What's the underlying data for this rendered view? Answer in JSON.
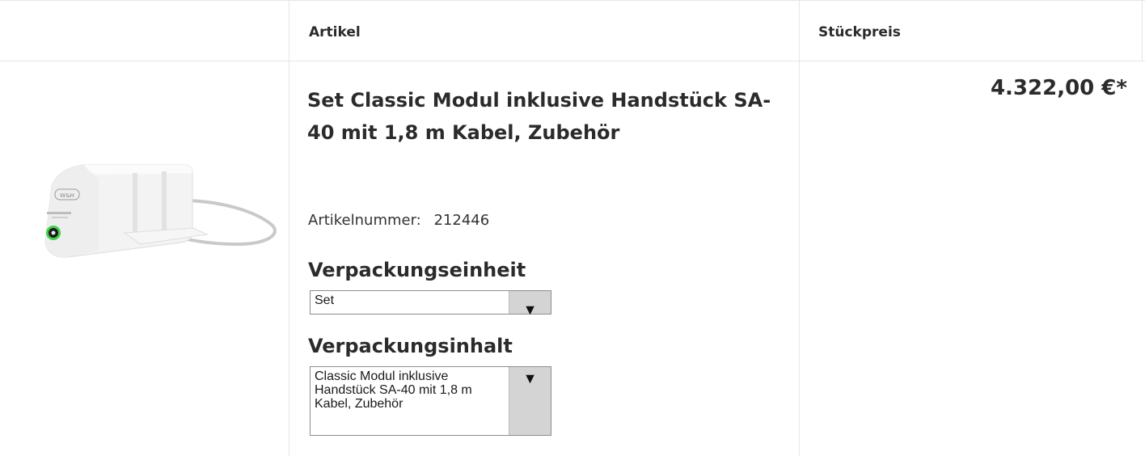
{
  "table": {
    "headers": {
      "image": "",
      "artikel": "Artikel",
      "stueckpreis": "Stückpreis"
    },
    "row": {
      "title": "Set Classic Modul inklusive Handstück SA-40 mit 1,8 m Kabel, Zubehör",
      "artikelnummer_label": "Artikelnummer:",
      "artikelnummer": "212446",
      "verpackungseinheit_label": "Verpackungseinheit",
      "verpackungseinheit_value": "Set",
      "verpackungsinhalt_label": "Verpackungsinhalt",
      "verpackungsinhalt_value": "Classic Modul inklusive Handstück SA-40 mit 1,8 m Kabel, Zubehör",
      "price": "4.322,00 €*",
      "dropdown_icon": "triangle-down-icon",
      "product_image": "product-photo"
    }
  },
  "colors": {
    "text": "#2b2b2b",
    "grid": "#e6e6e6",
    "select_border": "#8e8e8e",
    "select_arrow_bg": "#d4d4d4"
  }
}
